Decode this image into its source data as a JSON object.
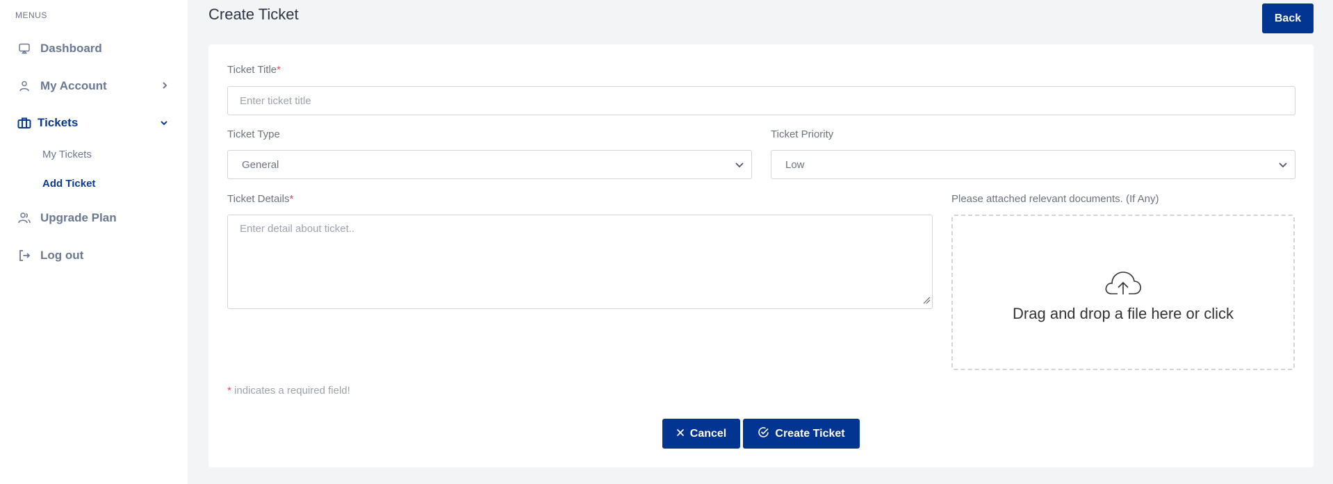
{
  "sidebar": {
    "section_label": "MENUS",
    "items": [
      {
        "label": "Dashboard",
        "icon": "monitor-icon"
      },
      {
        "label": "My Account",
        "icon": "user-icon"
      },
      {
        "label": "Tickets",
        "icon": "briefcase-icon"
      },
      {
        "label": "Upgrade Plan",
        "icon": "users-icon"
      },
      {
        "label": "Log out",
        "icon": "logout-icon"
      }
    ],
    "sub_items": [
      {
        "label": "My Tickets"
      },
      {
        "label": "Add Ticket",
        "active": true
      }
    ]
  },
  "header": {
    "title": "Create Ticket",
    "back_label": "Back"
  },
  "form": {
    "title_label": "Ticket Title",
    "title_placeholder": "Enter ticket title",
    "type_label": "Ticket Type",
    "type_value": "General",
    "priority_label": "Ticket Priority",
    "priority_value": "Low",
    "details_label": "Ticket Details",
    "details_placeholder": "Enter detail about ticket..",
    "attach_label": "Please attached relevant documents. (If Any)",
    "dropzone_text": "Drag and drop a file here or click",
    "required_mark": "*",
    "required_note": "indicates a required field!",
    "cancel_label": "Cancel",
    "create_label": "Create Ticket"
  },
  "colors": {
    "primary": "#023591",
    "required": "#ef4461",
    "sidebar_text": "#6b7891"
  }
}
